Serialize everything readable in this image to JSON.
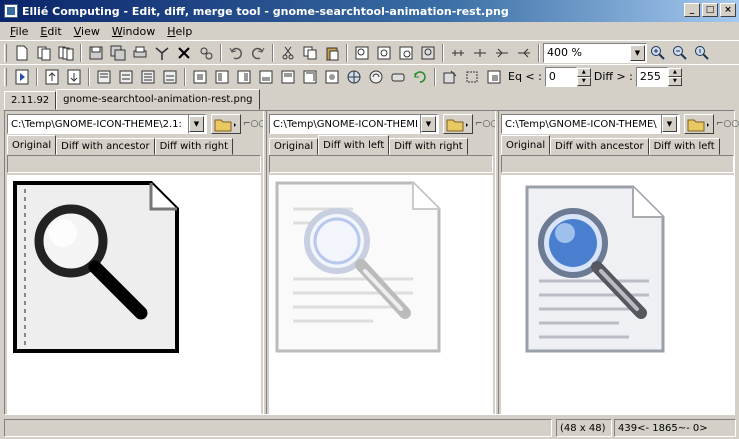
{
  "window": {
    "title": "Ellié Computing - Edit, diff, merge tool - gnome-searchtool-animation-rest.png",
    "minimize": "_",
    "maximize": "□",
    "close": "×"
  },
  "menu": [
    "File",
    "Edit",
    "View",
    "Window",
    "Help"
  ],
  "toolbar1": {
    "zoom_value": "400 %"
  },
  "toolbar2": {
    "eq_label": "Eq < :",
    "eq_value": "0",
    "diff_label": "Diff > :",
    "diff_value": "255"
  },
  "doc_tabs": [
    {
      "label": "2.11.92"
    },
    {
      "label": "gnome-searchtool-animation-rest.png"
    }
  ],
  "panes": [
    {
      "path": "C:\\Temp\\GNOME-ICON-THEME\\2.1:",
      "tabs": [
        "Original",
        "Diff with ancestor",
        "Diff with right"
      ],
      "active_tab": "Original"
    },
    {
      "path": "C:\\Temp\\GNOME-ICON-THEMI",
      "tabs": [
        "Original",
        "Diff with left",
        "Diff with right"
      ],
      "active_tab": "Diff with left"
    },
    {
      "path": "C:\\Temp\\GNOME-ICON-THEME\\",
      "tabs": [
        "Original",
        "Diff with ancestor",
        "Diff with left"
      ],
      "active_tab": "Original"
    }
  ],
  "status": {
    "size": "(48 x 48)",
    "position": "439<- 1865~- 0>"
  },
  "colors": {
    "title_start": "#0a246a",
    "title_end": "#a6caf0",
    "face": "#d4d0c8",
    "lens_blue": "#4a7fd0"
  }
}
